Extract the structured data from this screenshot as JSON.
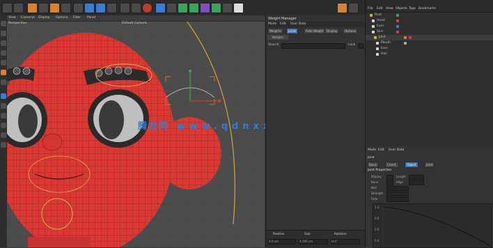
{
  "toolbar": {
    "icon_names": [
      "undo-icon",
      "redo-icon",
      "select-icon",
      "move-icon",
      "scale-icon",
      "rotate-icon",
      "axis-x-icon",
      "axis-y-icon",
      "axis-z-icon",
      "world-icon",
      "render-region-icon",
      "render-view-icon",
      "render-settings-icon",
      "cube-icon",
      "pen-icon",
      "subdivision-icon",
      "array-icon",
      "deformer-icon",
      "environment-icon",
      "camera-icon",
      "light-icon"
    ]
  },
  "viewport": {
    "menu": [
      "View",
      "Cameras",
      "Display",
      "Options",
      "Filter",
      "Panel"
    ],
    "title": "Perspective",
    "camera": "Default Camera"
  },
  "attributes": {
    "title": "Weight Manager",
    "menu": [
      "Mode",
      "Edit",
      "User Data"
    ],
    "tabs": [
      "Weights",
      "Joints",
      "Auto Weight",
      "Display",
      "Options"
    ],
    "active_tab": "Joints",
    "subtab": "Weights",
    "row_label": "Search",
    "lock_label": "Lock",
    "bottom_cols": [
      "Position",
      "Size",
      "Rotation"
    ],
    "bottom_values": [
      "X 0 cm",
      "X 200 cm",
      "H 0°"
    ]
  },
  "watermark": {
    "cn": "腾龙网",
    "url": "www.qdnxxfb.cn"
  },
  "object_manager": {
    "menu": [
      "File",
      "Edit",
      "View",
      "Objects",
      "Tags",
      "Bookmarks"
    ],
    "rows": [
      {
        "name": "Root",
        "color": "#d9b13a"
      },
      {
        "name": "Head",
        "color": "#d4d4d4"
      },
      {
        "name": "Eyes",
        "color": "#d4d4d4"
      },
      {
        "name": "Skin",
        "color": "#d4d4d4"
      },
      {
        "name": "Joint",
        "color": "#d9b13a"
      },
      {
        "name": "Mouth",
        "color": "#d4d4d4"
      },
      {
        "name": "Ears",
        "color": "#d4d4d4"
      },
      {
        "name": "Hair",
        "color": "#d4d4d4"
      }
    ]
  },
  "lower_panel": {
    "menu": [
      "Mode",
      "Edit",
      "User Data"
    ],
    "object": "Joint",
    "tabs": [
      "Basic",
      "Coord.",
      "Object",
      "Joint"
    ],
    "active_tab": "Object",
    "section": "Joint Properties",
    "props": [
      "Display",
      "Length",
      "Bone",
      "Align",
      "Null",
      "Strength",
      "Fade"
    ],
    "graph_labels": [
      "1.0",
      "0.8",
      "0.6",
      "0.4"
    ]
  }
}
